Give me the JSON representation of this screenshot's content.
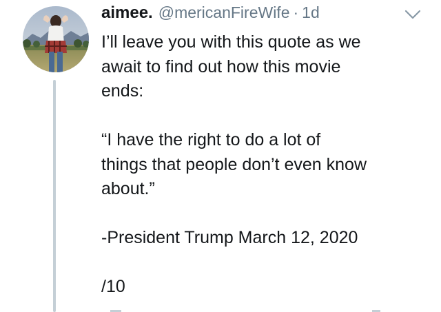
{
  "tweet": {
    "display_name": "aimee.",
    "handle": "@mericanFireWife",
    "separator": "·",
    "time": "1d",
    "lines": [
      "I’ll leave you with this quote as we",
      "await to find out how this movie",
      "ends:",
      "“I have the right to do a lot of",
      "things that people don’t even know",
      "about.”",
      "-President Trump March 12, 2020",
      "/10"
    ]
  },
  "colors": {
    "text": "#14171a",
    "secondary": "#657786",
    "thread_line": "#c4cfd6"
  },
  "icons": {
    "menu": "chevron-down-icon"
  }
}
